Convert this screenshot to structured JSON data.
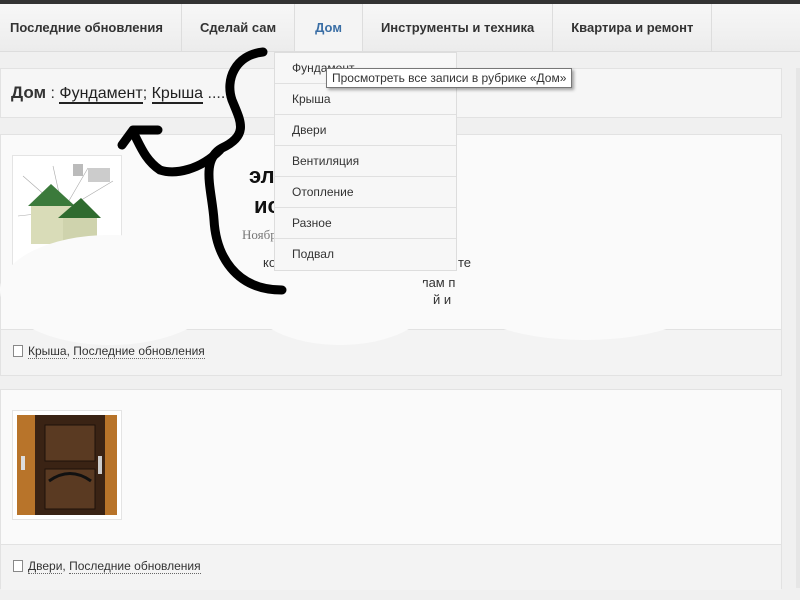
{
  "nav": {
    "items": [
      "Последние обновления",
      "Сделай сам",
      "Дом",
      "Инструменты и техника",
      "Квартира и ремонт"
    ],
    "active": "Дом"
  },
  "dropdown": {
    "items": [
      "Фундамент",
      "Крыша",
      "Двери",
      "Вентиляция",
      "Отопление",
      "Разное",
      "Подвал"
    ]
  },
  "tooltip": "Просмотреть все записи в рубрике «Дом»",
  "breadcrumb": {
    "title": "Дом",
    "sep": " : ",
    "links": [
      "Фундамент",
      "Крыша"
    ],
    "semicolon": "; ",
    "tail": " ....."
  },
  "posts": [
    {
      "title_frags": [
        "эл",
        "ис"
      ],
      "date_frag": "Ноябр",
      "text_frags": [
        "ко",
        "те",
        "телям и профессионалам п",
        "й и"
      ],
      "categories": [
        "Крыша",
        "Последние обновления"
      ]
    },
    {
      "categories": [
        "Двери",
        "Последние обновления"
      ]
    }
  ],
  "colors": {
    "accent": "#3a6ea5"
  }
}
